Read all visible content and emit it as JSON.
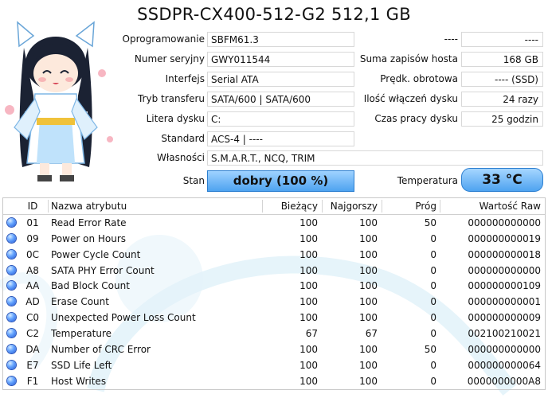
{
  "title": "SSDPR-CX400-512-G2 512,1 GB",
  "info_left": [
    {
      "label": "Oprogramowanie",
      "value": "SBFM61.3"
    },
    {
      "label": "Numer seryjny",
      "value": "GWY011544"
    },
    {
      "label": "Interfejs",
      "value": "Serial ATA"
    },
    {
      "label": "Tryb transferu",
      "value": "SATA/600 | SATA/600"
    },
    {
      "label": "Litera dysku",
      "value": "C:"
    },
    {
      "label": "Standard",
      "value": "ACS-4 | ----"
    },
    {
      "label": "Własności",
      "value": "S.M.A.R.T., NCQ, TRIM"
    }
  ],
  "info_right": [
    {
      "label": "----",
      "value": "----"
    },
    {
      "label": "Suma zapisów hosta",
      "value": "168 GB"
    },
    {
      "label": "Prędk. obrotowa",
      "value": "---- (SSD)"
    },
    {
      "label": "Ilość włączeń dysku",
      "value": "24 razy"
    },
    {
      "label": "Czas pracy dysku",
      "value": "25 godzin"
    }
  ],
  "status": {
    "label": "Stan",
    "value": "dobry  (100 %)",
    "color": "#4ea3f0"
  },
  "temperature": {
    "label": "Temperatura",
    "value": "33 °C",
    "color": "#4ea3f0"
  },
  "table": {
    "headers": {
      "id": "ID",
      "name": "Nazwa atrybutu",
      "current": "Bieżący",
      "worst": "Najgorszy",
      "threshold": "Próg",
      "raw": "Wartość Raw"
    },
    "rows": [
      {
        "id": "01",
        "name": "Read Error Rate",
        "current": "100",
        "worst": "100",
        "threshold": "50",
        "raw": "000000000000"
      },
      {
        "id": "09",
        "name": "Power on Hours",
        "current": "100",
        "worst": "100",
        "threshold": "0",
        "raw": "000000000019"
      },
      {
        "id": "0C",
        "name": "Power Cycle Count",
        "current": "100",
        "worst": "100",
        "threshold": "0",
        "raw": "000000000018"
      },
      {
        "id": "A8",
        "name": "SATA PHY Error Count",
        "current": "100",
        "worst": "100",
        "threshold": "0",
        "raw": "000000000000"
      },
      {
        "id": "AA",
        "name": "Bad Block Count",
        "current": "100",
        "worst": "100",
        "threshold": "0",
        "raw": "000000000109"
      },
      {
        "id": "AD",
        "name": "Erase Count",
        "current": "100",
        "worst": "100",
        "threshold": "0",
        "raw": "000000000001"
      },
      {
        "id": "C0",
        "name": "Unexpected Power Loss Count",
        "current": "100",
        "worst": "100",
        "threshold": "0",
        "raw": "000000000009"
      },
      {
        "id": "C2",
        "name": "Temperature",
        "current": "67",
        "worst": "67",
        "threshold": "0",
        "raw": "002100210021"
      },
      {
        "id": "DA",
        "name": "Number of CRC Error",
        "current": "100",
        "worst": "100",
        "threshold": "50",
        "raw": "000000000000"
      },
      {
        "id": "E7",
        "name": "SSD Life Left",
        "current": "100",
        "worst": "100",
        "threshold": "0",
        "raw": "000000000064"
      },
      {
        "id": "F1",
        "name": "Host Writes",
        "current": "100",
        "worst": "100",
        "threshold": "0",
        "raw": "0000000000A8"
      }
    ]
  },
  "status_dot_color": "#1f56d8"
}
